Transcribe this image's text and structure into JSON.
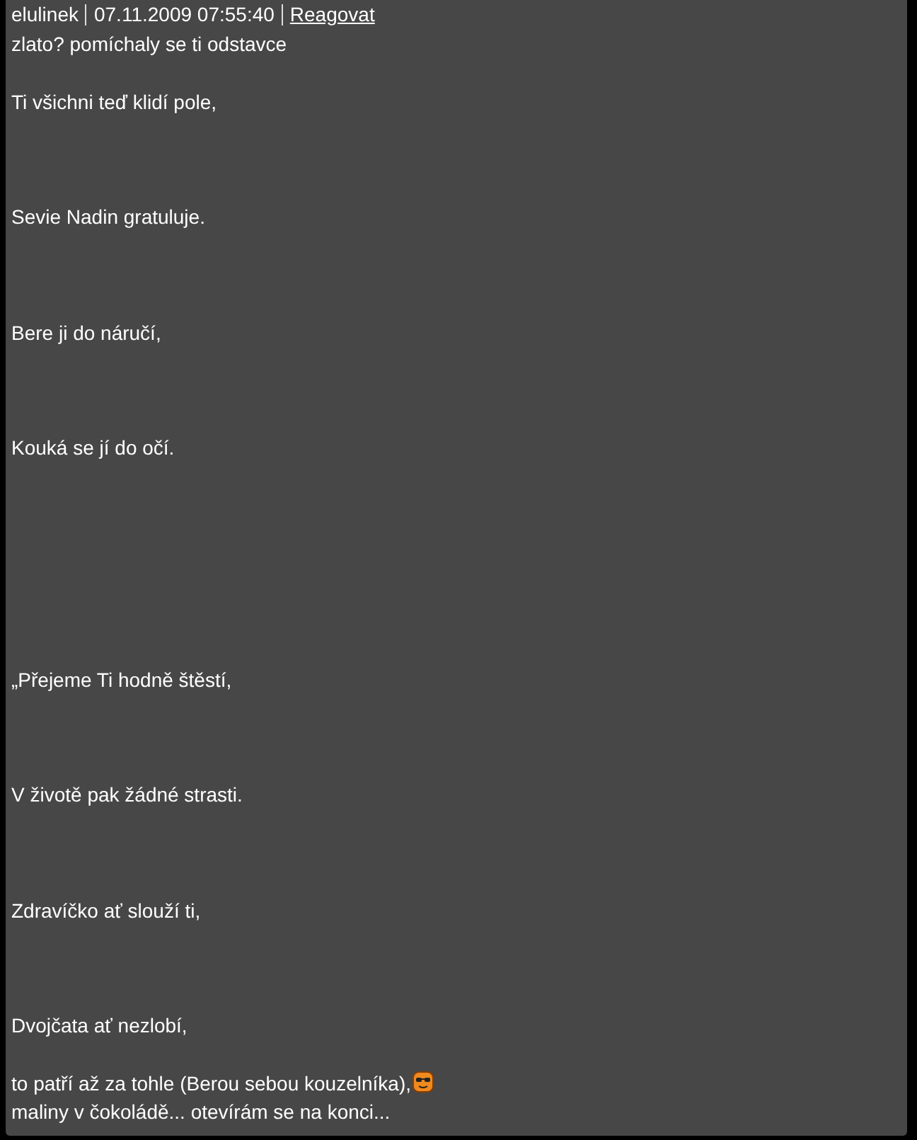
{
  "comment": {
    "author": "elulinek",
    "timestamp": "07.11.2009 07:55:40",
    "reply_link": "Reagovat",
    "lines": [
      {
        "kind": "text",
        "text": "zlato? pomíchaly se ti odstavce"
      },
      {
        "kind": "blank"
      },
      {
        "kind": "text",
        "text": "Ti všichni teď klidí pole,"
      },
      {
        "kind": "blank"
      },
      {
        "kind": "blank"
      },
      {
        "kind": "blank"
      },
      {
        "kind": "text",
        "text": "Sevie Nadin gratuluje."
      },
      {
        "kind": "blank"
      },
      {
        "kind": "blank"
      },
      {
        "kind": "blank"
      },
      {
        "kind": "text",
        "text": "Bere ji do náručí,"
      },
      {
        "kind": "blank"
      },
      {
        "kind": "blank"
      },
      {
        "kind": "blank"
      },
      {
        "kind": "text",
        "text": "Kouká se jí do očí."
      },
      {
        "kind": "blank"
      },
      {
        "kind": "blank"
      },
      {
        "kind": "blank"
      },
      {
        "kind": "blank"
      },
      {
        "kind": "blank"
      },
      {
        "kind": "blank"
      },
      {
        "kind": "blank"
      },
      {
        "kind": "text",
        "text": "„Přejeme Ti hodně štěstí,"
      },
      {
        "kind": "blank"
      },
      {
        "kind": "blank"
      },
      {
        "kind": "blank"
      },
      {
        "kind": "text",
        "text": "V životě pak žádné strasti."
      },
      {
        "kind": "blank"
      },
      {
        "kind": "blank"
      },
      {
        "kind": "blank"
      },
      {
        "kind": "text",
        "text": "Zdravíčko ať slouží ti,"
      },
      {
        "kind": "blank"
      },
      {
        "kind": "blank"
      },
      {
        "kind": "blank"
      },
      {
        "kind": "text",
        "text": "Dvojčata ať nezlobí,"
      },
      {
        "kind": "blank"
      },
      {
        "kind": "text",
        "text": "to patří až za tohle (Berou sebou kouzelníka),",
        "emoticon": true
      },
      {
        "kind": "text",
        "text": "maliny v čokoládě... otevírám se na konci..."
      }
    ]
  }
}
